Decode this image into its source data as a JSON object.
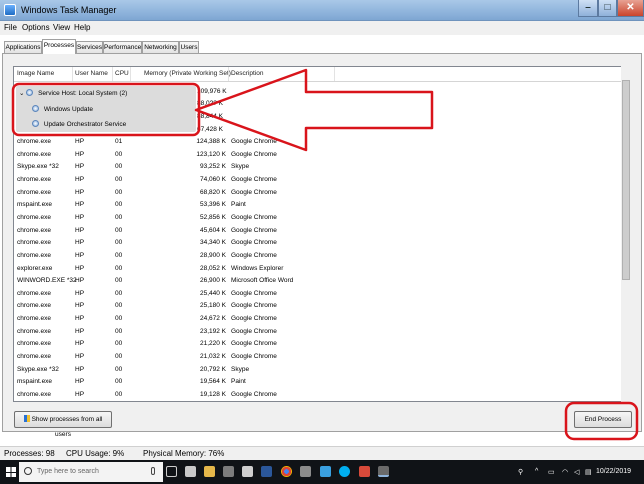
{
  "window": {
    "title": "Windows Task Manager"
  },
  "menu": [
    "File",
    "Options",
    "View",
    "Help"
  ],
  "tabs": [
    {
      "label": "Applications",
      "active": false
    },
    {
      "label": "Processes",
      "active": true
    },
    {
      "label": "Services",
      "active": false
    },
    {
      "label": "Performance",
      "active": false
    },
    {
      "label": "Networking",
      "active": false
    },
    {
      "label": "Users",
      "active": false
    }
  ],
  "columns": [
    "Image Name",
    "User Name",
    "CPU",
    "Memory (Private Working Set)",
    "Description"
  ],
  "group": {
    "title": "Service Host: Local System (2)",
    "title_memory": "109,976 K",
    "children": [
      {
        "name": "Windows Update",
        "memory": "88,0?? K"
      },
      {
        "name": "Update Orchestrator Service",
        "memory": "88,844 K"
      }
    ],
    "after_memory": "67,428 K"
  },
  "processes": [
    {
      "name": "chrome.exe",
      "user": "HP",
      "cpu": "01",
      "memory": "124,388 K",
      "desc": "Google Chrome"
    },
    {
      "name": "chrome.exe",
      "user": "HP",
      "cpu": "00",
      "memory": "123,120 K",
      "desc": "Google Chrome"
    },
    {
      "name": "Skype.exe *32",
      "user": "HP",
      "cpu": "00",
      "memory": "93,252 K",
      "desc": "Skype"
    },
    {
      "name": "chrome.exe",
      "user": "HP",
      "cpu": "00",
      "memory": "74,060 K",
      "desc": "Google Chrome"
    },
    {
      "name": "chrome.exe",
      "user": "HP",
      "cpu": "00",
      "memory": "68,820 K",
      "desc": "Google Chrome"
    },
    {
      "name": "mspaint.exe",
      "user": "HP",
      "cpu": "00",
      "memory": "53,396 K",
      "desc": "Paint"
    },
    {
      "name": "chrome.exe",
      "user": "HP",
      "cpu": "00",
      "memory": "52,856 K",
      "desc": "Google Chrome"
    },
    {
      "name": "chrome.exe",
      "user": "HP",
      "cpu": "00",
      "memory": "45,604 K",
      "desc": "Google Chrome"
    },
    {
      "name": "chrome.exe",
      "user": "HP",
      "cpu": "00",
      "memory": "34,340 K",
      "desc": "Google Chrome"
    },
    {
      "name": "chrome.exe",
      "user": "HP",
      "cpu": "00",
      "memory": "28,900 K",
      "desc": "Google Chrome"
    },
    {
      "name": "explorer.exe",
      "user": "HP",
      "cpu": "00",
      "memory": "28,052 K",
      "desc": "Windows Explorer"
    },
    {
      "name": "WINWORD.EXE *32",
      "user": "HP",
      "cpu": "00",
      "memory": "26,900 K",
      "desc": "Microsoft Office Word"
    },
    {
      "name": "chrome.exe",
      "user": "HP",
      "cpu": "00",
      "memory": "25,440 K",
      "desc": "Google Chrome"
    },
    {
      "name": "chrome.exe",
      "user": "HP",
      "cpu": "00",
      "memory": "25,180 K",
      "desc": "Google Chrome"
    },
    {
      "name": "chrome.exe",
      "user": "HP",
      "cpu": "00",
      "memory": "24,672 K",
      "desc": "Google Chrome"
    },
    {
      "name": "chrome.exe",
      "user": "HP",
      "cpu": "00",
      "memory": "23,192 K",
      "desc": "Google Chrome"
    },
    {
      "name": "chrome.exe",
      "user": "HP",
      "cpu": "00",
      "memory": "21,220 K",
      "desc": "Google Chrome"
    },
    {
      "name": "chrome.exe",
      "user": "HP",
      "cpu": "00",
      "memory": "21,032 K",
      "desc": "Google Chrome"
    },
    {
      "name": "Skype.exe *32",
      "user": "HP",
      "cpu": "00",
      "memory": "20,792 K",
      "desc": "Skype"
    },
    {
      "name": "mspaint.exe",
      "user": "HP",
      "cpu": "00",
      "memory": "19,564 K",
      "desc": "Paint"
    },
    {
      "name": "chrome.exe",
      "user": "HP",
      "cpu": "00",
      "memory": "19,128 K",
      "desc": "Google Chrome"
    }
  ],
  "buttons": {
    "show_all": "Show processes from all users",
    "end_process": "End Process"
  },
  "status": {
    "processes": "Processes: 98",
    "cpu": "CPU Usage: 9%",
    "memory": "Physical Memory: 76%"
  },
  "taskbar": {
    "search_placeholder": "Type here to search",
    "date": "10/22/2019"
  },
  "colors": {
    "annotation": "#d9141b",
    "titlebar": "#8fb4dc",
    "taskbar": "#101317"
  }
}
